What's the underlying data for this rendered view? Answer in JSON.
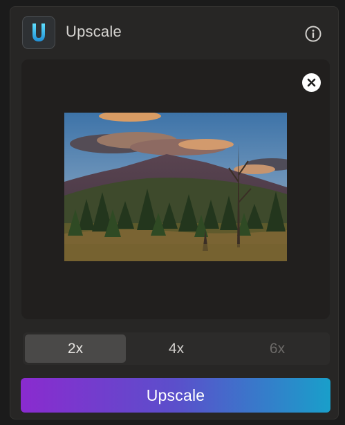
{
  "header": {
    "title": "Upscale",
    "app_icon": "upscale-logo-icon",
    "info_icon": "info-icon"
  },
  "preview": {
    "remove_icon": "close-icon",
    "image": "mountain-landscape-photo"
  },
  "scale_options": [
    {
      "label": "2x",
      "state": "selected"
    },
    {
      "label": "4x",
      "state": "enabled"
    },
    {
      "label": "6x",
      "state": "disabled"
    }
  ],
  "action": {
    "label": "Upscale",
    "gradient": [
      "#8a2bcf",
      "#5b4fcb",
      "#199fca"
    ]
  },
  "colors": {
    "background": "#1b1b1b",
    "panel": "#272625",
    "canvas": "#211f1e",
    "segment_selected": "#4a4948"
  }
}
